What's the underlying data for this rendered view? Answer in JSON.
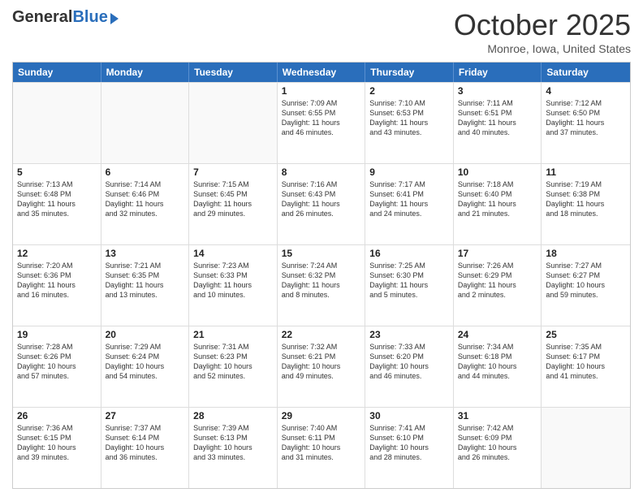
{
  "logo": {
    "general": "General",
    "blue": "Blue"
  },
  "title": "October 2025",
  "location": "Monroe, Iowa, United States",
  "days_of_week": [
    "Sunday",
    "Monday",
    "Tuesday",
    "Wednesday",
    "Thursday",
    "Friday",
    "Saturday"
  ],
  "weeks": [
    [
      {
        "day": "",
        "info": ""
      },
      {
        "day": "",
        "info": ""
      },
      {
        "day": "",
        "info": ""
      },
      {
        "day": "1",
        "info": "Sunrise: 7:09 AM\nSunset: 6:55 PM\nDaylight: 11 hours\nand 46 minutes."
      },
      {
        "day": "2",
        "info": "Sunrise: 7:10 AM\nSunset: 6:53 PM\nDaylight: 11 hours\nand 43 minutes."
      },
      {
        "day": "3",
        "info": "Sunrise: 7:11 AM\nSunset: 6:51 PM\nDaylight: 11 hours\nand 40 minutes."
      },
      {
        "day": "4",
        "info": "Sunrise: 7:12 AM\nSunset: 6:50 PM\nDaylight: 11 hours\nand 37 minutes."
      }
    ],
    [
      {
        "day": "5",
        "info": "Sunrise: 7:13 AM\nSunset: 6:48 PM\nDaylight: 11 hours\nand 35 minutes."
      },
      {
        "day": "6",
        "info": "Sunrise: 7:14 AM\nSunset: 6:46 PM\nDaylight: 11 hours\nand 32 minutes."
      },
      {
        "day": "7",
        "info": "Sunrise: 7:15 AM\nSunset: 6:45 PM\nDaylight: 11 hours\nand 29 minutes."
      },
      {
        "day": "8",
        "info": "Sunrise: 7:16 AM\nSunset: 6:43 PM\nDaylight: 11 hours\nand 26 minutes."
      },
      {
        "day": "9",
        "info": "Sunrise: 7:17 AM\nSunset: 6:41 PM\nDaylight: 11 hours\nand 24 minutes."
      },
      {
        "day": "10",
        "info": "Sunrise: 7:18 AM\nSunset: 6:40 PM\nDaylight: 11 hours\nand 21 minutes."
      },
      {
        "day": "11",
        "info": "Sunrise: 7:19 AM\nSunset: 6:38 PM\nDaylight: 11 hours\nand 18 minutes."
      }
    ],
    [
      {
        "day": "12",
        "info": "Sunrise: 7:20 AM\nSunset: 6:36 PM\nDaylight: 11 hours\nand 16 minutes."
      },
      {
        "day": "13",
        "info": "Sunrise: 7:21 AM\nSunset: 6:35 PM\nDaylight: 11 hours\nand 13 minutes."
      },
      {
        "day": "14",
        "info": "Sunrise: 7:23 AM\nSunset: 6:33 PM\nDaylight: 11 hours\nand 10 minutes."
      },
      {
        "day": "15",
        "info": "Sunrise: 7:24 AM\nSunset: 6:32 PM\nDaylight: 11 hours\nand 8 minutes."
      },
      {
        "day": "16",
        "info": "Sunrise: 7:25 AM\nSunset: 6:30 PM\nDaylight: 11 hours\nand 5 minutes."
      },
      {
        "day": "17",
        "info": "Sunrise: 7:26 AM\nSunset: 6:29 PM\nDaylight: 11 hours\nand 2 minutes."
      },
      {
        "day": "18",
        "info": "Sunrise: 7:27 AM\nSunset: 6:27 PM\nDaylight: 10 hours\nand 59 minutes."
      }
    ],
    [
      {
        "day": "19",
        "info": "Sunrise: 7:28 AM\nSunset: 6:26 PM\nDaylight: 10 hours\nand 57 minutes."
      },
      {
        "day": "20",
        "info": "Sunrise: 7:29 AM\nSunset: 6:24 PM\nDaylight: 10 hours\nand 54 minutes."
      },
      {
        "day": "21",
        "info": "Sunrise: 7:31 AM\nSunset: 6:23 PM\nDaylight: 10 hours\nand 52 minutes."
      },
      {
        "day": "22",
        "info": "Sunrise: 7:32 AM\nSunset: 6:21 PM\nDaylight: 10 hours\nand 49 minutes."
      },
      {
        "day": "23",
        "info": "Sunrise: 7:33 AM\nSunset: 6:20 PM\nDaylight: 10 hours\nand 46 minutes."
      },
      {
        "day": "24",
        "info": "Sunrise: 7:34 AM\nSunset: 6:18 PM\nDaylight: 10 hours\nand 44 minutes."
      },
      {
        "day": "25",
        "info": "Sunrise: 7:35 AM\nSunset: 6:17 PM\nDaylight: 10 hours\nand 41 minutes."
      }
    ],
    [
      {
        "day": "26",
        "info": "Sunrise: 7:36 AM\nSunset: 6:15 PM\nDaylight: 10 hours\nand 39 minutes."
      },
      {
        "day": "27",
        "info": "Sunrise: 7:37 AM\nSunset: 6:14 PM\nDaylight: 10 hours\nand 36 minutes."
      },
      {
        "day": "28",
        "info": "Sunrise: 7:39 AM\nSunset: 6:13 PM\nDaylight: 10 hours\nand 33 minutes."
      },
      {
        "day": "29",
        "info": "Sunrise: 7:40 AM\nSunset: 6:11 PM\nDaylight: 10 hours\nand 31 minutes."
      },
      {
        "day": "30",
        "info": "Sunrise: 7:41 AM\nSunset: 6:10 PM\nDaylight: 10 hours\nand 28 minutes."
      },
      {
        "day": "31",
        "info": "Sunrise: 7:42 AM\nSunset: 6:09 PM\nDaylight: 10 hours\nand 26 minutes."
      },
      {
        "day": "",
        "info": ""
      }
    ]
  ]
}
